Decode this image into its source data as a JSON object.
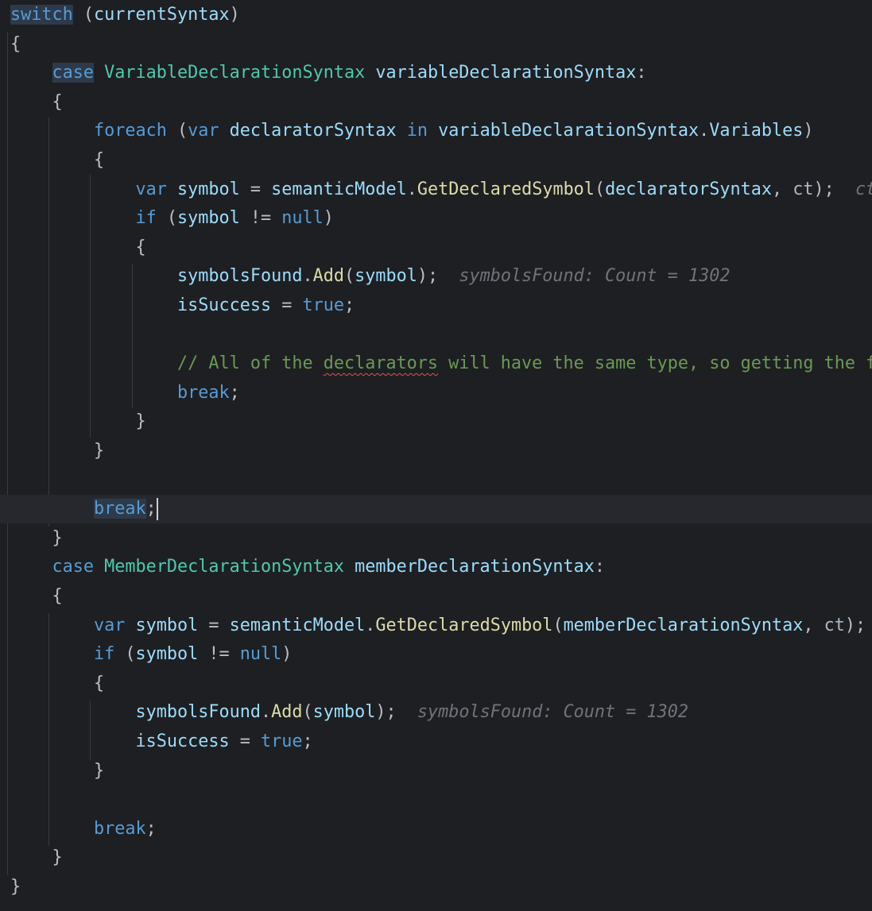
{
  "editor": {
    "lines": [
      [
        {
          "t": "switch",
          "c": "kw",
          "hl": true
        },
        {
          "t": " (",
          "c": "pn"
        },
        {
          "t": "currentSyntax",
          "c": "vr"
        },
        {
          "t": ")",
          "c": "pn"
        }
      ],
      [
        {
          "t": "{",
          "c": "pn"
        }
      ],
      [
        {
          "t": "    ",
          "c": "pn"
        },
        {
          "t": "case",
          "c": "kw",
          "hl": true
        },
        {
          "t": " ",
          "c": "pn"
        },
        {
          "t": "VariableDeclarationSyntax",
          "c": "ty"
        },
        {
          "t": " ",
          "c": "pn"
        },
        {
          "t": "variableDeclarationSyntax",
          "c": "vr"
        },
        {
          "t": ":",
          "c": "pn"
        }
      ],
      [
        {
          "t": "    {",
          "c": "pn"
        }
      ],
      [
        {
          "t": "        ",
          "c": "pn"
        },
        {
          "t": "foreach",
          "c": "kw"
        },
        {
          "t": " (",
          "c": "pn"
        },
        {
          "t": "var",
          "c": "kw"
        },
        {
          "t": " ",
          "c": "pn"
        },
        {
          "t": "declaratorSyntax",
          "c": "vr"
        },
        {
          "t": " ",
          "c": "pn"
        },
        {
          "t": "in",
          "c": "kw"
        },
        {
          "t": " ",
          "c": "pn"
        },
        {
          "t": "variableDeclarationSyntax",
          "c": "vr"
        },
        {
          "t": ".",
          "c": "pn"
        },
        {
          "t": "Variables",
          "c": "vr"
        },
        {
          "t": ")",
          "c": "pn"
        }
      ],
      [
        {
          "t": "        {",
          "c": "pn"
        }
      ],
      [
        {
          "t": "            ",
          "c": "pn"
        },
        {
          "t": "var",
          "c": "kw"
        },
        {
          "t": " ",
          "c": "pn"
        },
        {
          "t": "symbol",
          "c": "vr"
        },
        {
          "t": " = ",
          "c": "pn"
        },
        {
          "t": "semanticModel",
          "c": "vr"
        },
        {
          "t": ".",
          "c": "pn"
        },
        {
          "t": "GetDeclaredSymbol",
          "c": "fn"
        },
        {
          "t": "(",
          "c": "pn"
        },
        {
          "t": "declaratorSyntax",
          "c": "vr"
        },
        {
          "t": ", ",
          "c": "pn"
        },
        {
          "t": "ct",
          "c": "pm"
        },
        {
          "t": ");",
          "c": "pn"
        },
        {
          "t": "  ",
          "c": "pn"
        },
        {
          "t": "ct",
          "c": "hint"
        }
      ],
      [
        {
          "t": "            ",
          "c": "pn"
        },
        {
          "t": "if",
          "c": "kw"
        },
        {
          "t": " (",
          "c": "pn"
        },
        {
          "t": "symbol",
          "c": "vr"
        },
        {
          "t": " != ",
          "c": "pn"
        },
        {
          "t": "null",
          "c": "kw"
        },
        {
          "t": ")",
          "c": "pn"
        }
      ],
      [
        {
          "t": "            {",
          "c": "pn"
        }
      ],
      [
        {
          "t": "                ",
          "c": "pn"
        },
        {
          "t": "symbolsFound",
          "c": "vr"
        },
        {
          "t": ".",
          "c": "pn"
        },
        {
          "t": "Add",
          "c": "fn"
        },
        {
          "t": "(",
          "c": "pn"
        },
        {
          "t": "symbol",
          "c": "vr"
        },
        {
          "t": ");",
          "c": "pn"
        },
        {
          "t": "  ",
          "c": "pn"
        },
        {
          "t": "symbolsFound: Count = 1302",
          "c": "hint"
        }
      ],
      [
        {
          "t": "                ",
          "c": "pn"
        },
        {
          "t": "isSuccess",
          "c": "vr"
        },
        {
          "t": " = ",
          "c": "pn"
        },
        {
          "t": "true",
          "c": "kw"
        },
        {
          "t": ";",
          "c": "pn"
        }
      ],
      [],
      [
        {
          "t": "                ",
          "c": "pn"
        },
        {
          "t": "// All of the ",
          "c": "cm"
        },
        {
          "t": "declarators",
          "c": "cm",
          "sq": true
        },
        {
          "t": " will have the same type, so getting the fi",
          "c": "cm"
        }
      ],
      [
        {
          "t": "                ",
          "c": "pn"
        },
        {
          "t": "break",
          "c": "kw"
        },
        {
          "t": ";",
          "c": "pn"
        }
      ],
      [
        {
          "t": "            }",
          "c": "pn"
        }
      ],
      [
        {
          "t": "        }",
          "c": "pn"
        }
      ],
      [],
      [
        {
          "t": "        ",
          "c": "pn"
        },
        {
          "t": "break",
          "c": "kw",
          "hl": true
        },
        {
          "t": ";",
          "c": "pn"
        }
      ],
      [
        {
          "t": "    }",
          "c": "pn"
        }
      ],
      [
        {
          "t": "    ",
          "c": "pn"
        },
        {
          "t": "case",
          "c": "kw"
        },
        {
          "t": " ",
          "c": "pn"
        },
        {
          "t": "MemberDeclarationSyntax",
          "c": "ty"
        },
        {
          "t": " ",
          "c": "pn"
        },
        {
          "t": "memberDeclarationSyntax",
          "c": "vr"
        },
        {
          "t": ":",
          "c": "pn"
        }
      ],
      [
        {
          "t": "    {",
          "c": "pn"
        }
      ],
      [
        {
          "t": "        ",
          "c": "pn"
        },
        {
          "t": "var",
          "c": "kw"
        },
        {
          "t": " ",
          "c": "pn"
        },
        {
          "t": "symbol",
          "c": "vr"
        },
        {
          "t": " = ",
          "c": "pn"
        },
        {
          "t": "semanticModel",
          "c": "vr"
        },
        {
          "t": ".",
          "c": "pn"
        },
        {
          "t": "GetDeclaredSymbol",
          "c": "fn"
        },
        {
          "t": "(",
          "c": "pn"
        },
        {
          "t": "memberDeclarationSyntax",
          "c": "vr"
        },
        {
          "t": ", ",
          "c": "pn"
        },
        {
          "t": "ct",
          "c": "pm"
        },
        {
          "t": ");",
          "c": "pn"
        }
      ],
      [
        {
          "t": "        ",
          "c": "pn"
        },
        {
          "t": "if",
          "c": "kw"
        },
        {
          "t": " (",
          "c": "pn"
        },
        {
          "t": "symbol",
          "c": "vr"
        },
        {
          "t": " != ",
          "c": "pn"
        },
        {
          "t": "null",
          "c": "kw"
        },
        {
          "t": ")",
          "c": "pn"
        }
      ],
      [
        {
          "t": "        {",
          "c": "pn"
        }
      ],
      [
        {
          "t": "            ",
          "c": "pn"
        },
        {
          "t": "symbolsFound",
          "c": "vr"
        },
        {
          "t": ".",
          "c": "pn"
        },
        {
          "t": "Add",
          "c": "fn"
        },
        {
          "t": "(",
          "c": "pn"
        },
        {
          "t": "symbol",
          "c": "vr"
        },
        {
          "t": ");",
          "c": "pn"
        },
        {
          "t": "  ",
          "c": "pn"
        },
        {
          "t": "symbolsFound: Count = 1302",
          "c": "hint"
        }
      ],
      [
        {
          "t": "            ",
          "c": "pn"
        },
        {
          "t": "isSuccess",
          "c": "vr"
        },
        {
          "t": " = ",
          "c": "pn"
        },
        {
          "t": "true",
          "c": "kw"
        },
        {
          "t": ";",
          "c": "pn"
        }
      ],
      [
        {
          "t": "        }",
          "c": "pn"
        }
      ],
      [],
      [
        {
          "t": "        ",
          "c": "pn"
        },
        {
          "t": "break",
          "c": "kw"
        },
        {
          "t": ";",
          "c": "pn"
        }
      ],
      [
        {
          "t": "    }",
          "c": "pn"
        }
      ],
      [
        {
          "t": "}",
          "c": "pn"
        }
      ]
    ],
    "current_line": 17,
    "caret_after_token": 2,
    "colors": {
      "background": "#1e1f22",
      "current_line": "#26282e",
      "keyword": "#569cd6",
      "type": "#4ec9b0",
      "method": "#dcdcaa",
      "identifier": "#9cdcfe",
      "comment": "#6a9955",
      "inlay_hint": "#6f737a",
      "indent_guide": "#393b40"
    }
  }
}
